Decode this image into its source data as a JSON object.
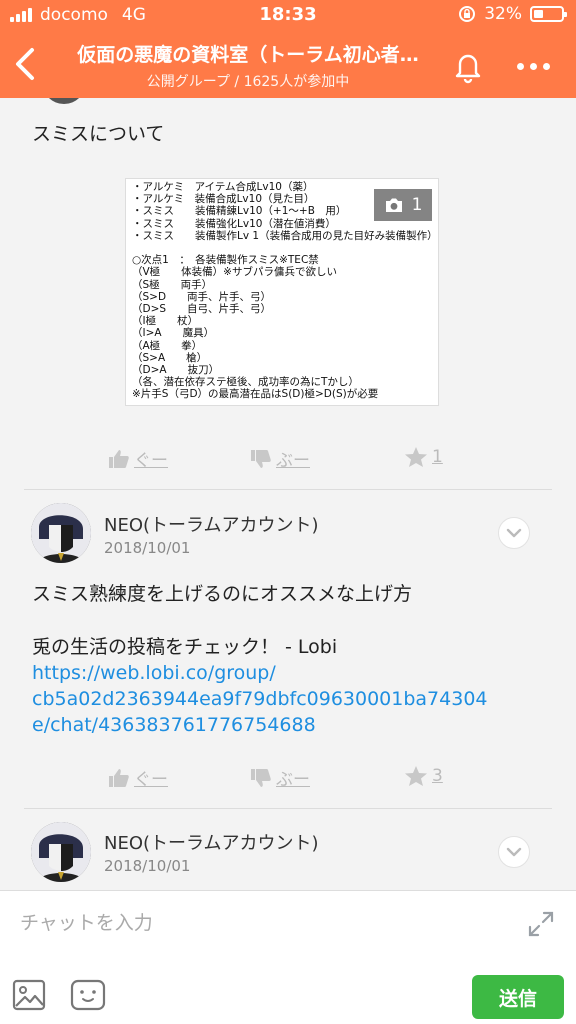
{
  "status": {
    "carrier": "docomo",
    "network": "4G",
    "time": "18:33",
    "battery": "32%"
  },
  "header": {
    "title": "仮面の悪魔の資料室（トーラム初心者…",
    "subtitle": "公開グループ / 1625人が参加中"
  },
  "posts": [
    {
      "text": "スミスについて",
      "image_count": "1",
      "image_lines": [
        "・アルケミ　アイテム合成Lv10（薬）",
        "・アルケミ　装備合成Lv10（見た目）",
        "・スミス　　装備精錬Lv10（+1〜+B　用）",
        "・スミス　　装備強化Lv10（潜在値消費）",
        "・スミス　　装備製作Lv 1（装備合成用の見た目好み装備製作）",
        "",
        "○次点1　：　各装備製作スミス※TEC禁",
        "（V極　　体装備）※サブパラ傭兵で欲しい",
        "（S極　　両手）",
        "（S>D　　両手、片手、弓）",
        "（D>S　　自弓、片手、弓）",
        "（I極　　杖）",
        "（I>A　　魔具）",
        "（A極　　拳）",
        "（S>A　　槍）",
        "（D>A　　抜刀）",
        "（各、潜在依存ステ極後、成功率の為にTかし）",
        "※片手S（弓D）の最高潜在品はS(D)極>D(S)が必要"
      ],
      "like_label": "ぐー",
      "dislike_label": "ぶー",
      "star_count": "1"
    },
    {
      "author": "NEO(トーラムアカウント)",
      "date": "2018/10/01",
      "text_line1": "スミス熟練度を上げるのにオススメな上げ方",
      "text_line2": "兎の生活の投稿をチェック！ - Lobi",
      "link_line1": "https://web.lobi.co/group/",
      "link_line2": "cb5a02d2363944ea9f79dbfc09630001ba74304",
      "link_line3": "e/chat/436383761776754688",
      "like_label": "ぐー",
      "dislike_label": "ぶー",
      "star_count": "3"
    },
    {
      "author": "NEO(トーラムアカウント)",
      "date": "2018/10/01"
    }
  ],
  "input": {
    "placeholder": "チャットを入力",
    "send_label": "送信"
  },
  "colors": {
    "header": "#ff7a47",
    "link": "#1e8ee0",
    "send": "#3db944"
  }
}
